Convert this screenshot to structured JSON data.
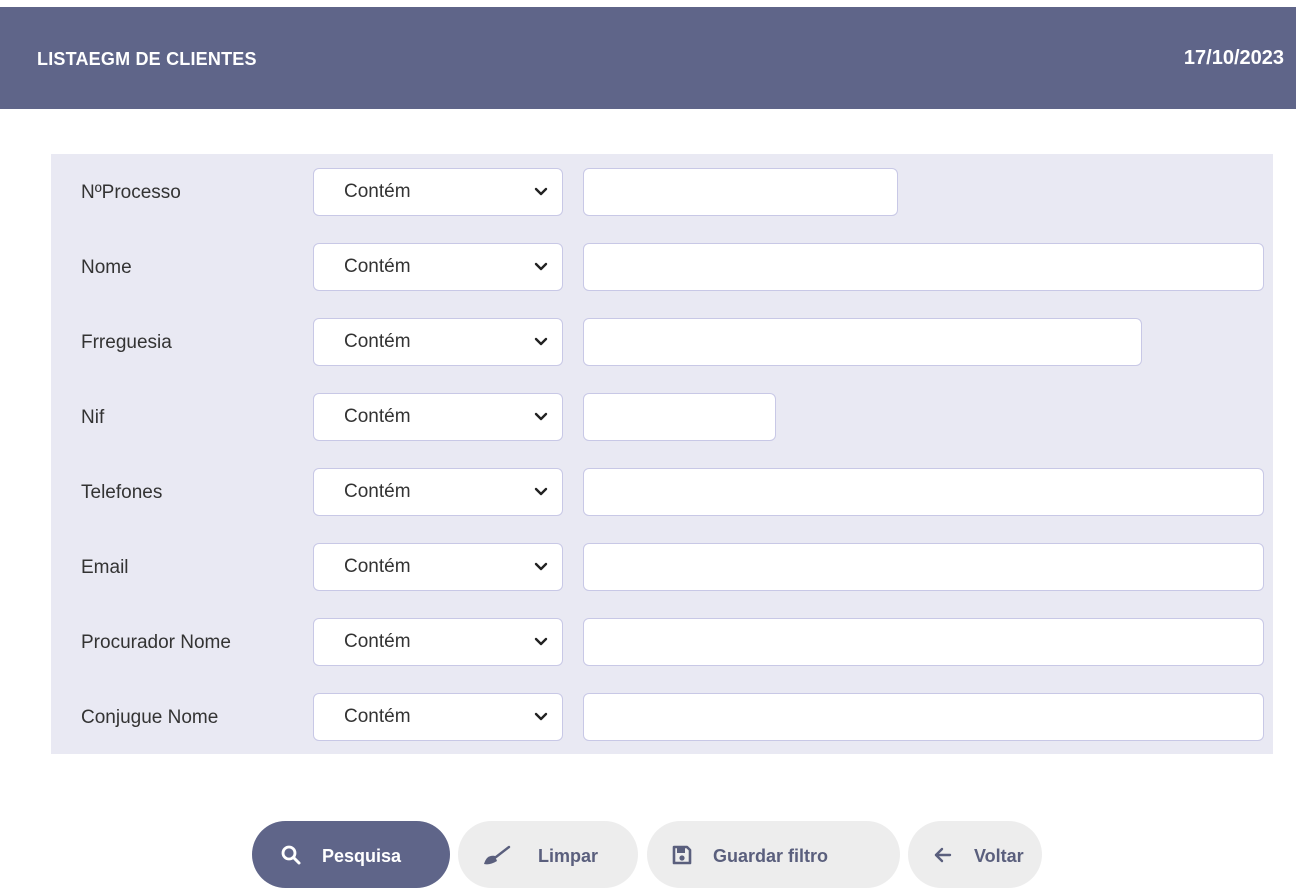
{
  "header": {
    "title": "LISTAEGM DE CLIENTES",
    "date": "17/10/2023"
  },
  "filters": [
    {
      "label": "NºProcesso",
      "operator": "Contém",
      "value": ""
    },
    {
      "label": "Nome",
      "operator": "Contém",
      "value": ""
    },
    {
      "label": "Frreguesia",
      "operator": "Contém",
      "value": ""
    },
    {
      "label": "Nif",
      "operator": "Contém",
      "value": ""
    },
    {
      "label": "Telefones",
      "operator": "Contém",
      "value": ""
    },
    {
      "label": "Email",
      "operator": "Contém",
      "value": ""
    },
    {
      "label": "Procurador Nome",
      "operator": "Contém",
      "value": ""
    },
    {
      "label": "Conjugue Nome",
      "operator": "Contém",
      "value": ""
    }
  ],
  "actions": {
    "search_label": "Pesquisa",
    "search_icon": "search-icon",
    "clear_label": "Limpar",
    "clear_icon": "broom-icon",
    "save_label": "Guardar filtro",
    "save_icon": "floppy-disk-icon",
    "back_label": "Voltar",
    "back_icon": "arrow-left-icon"
  },
  "colors": {
    "header_bg": "#5f6589",
    "panel_bg": "#e9e9f3",
    "primary_button": "#5f6589",
    "secondary_button": "#ededed"
  }
}
